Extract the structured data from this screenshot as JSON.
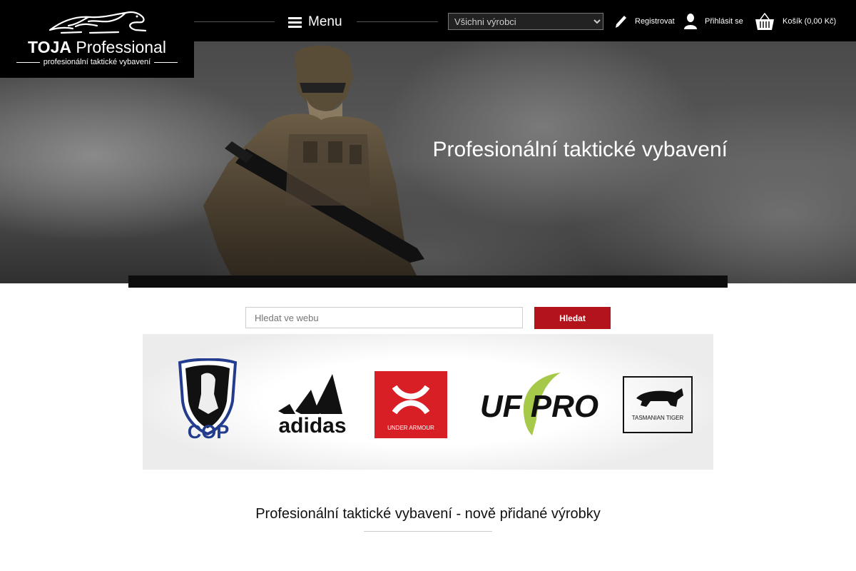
{
  "logo": {
    "title_bold": "TOJA",
    "title_rest": " Professional",
    "subtitle": "profesionální taktické vybavení",
    "icon": "panther-icon"
  },
  "nav": {
    "menu_label": "Menu",
    "maker_select": {
      "selected": "Všichni výrobci",
      "options": [
        "Všichni výrobci"
      ]
    },
    "register_label": "Registrovat",
    "login_label": "Přihlásit se",
    "cart_label": "Košík (0,00 Kč)"
  },
  "hero": {
    "title": "Profesionální taktické vybavení"
  },
  "search": {
    "placeholder": "Hledat ve webu",
    "button_label": "Hledat"
  },
  "brands": [
    {
      "name": "COP"
    },
    {
      "name": "adidas"
    },
    {
      "name": "UNDER ARMOUR"
    },
    {
      "name": "UF PRO"
    },
    {
      "name": "TASMANIAN TIGER"
    }
  ],
  "section": {
    "title": "Profesionální taktické vybavení - nově přidané výrobky"
  },
  "colors": {
    "accent": "#b3141b",
    "topbar": "#000000"
  }
}
